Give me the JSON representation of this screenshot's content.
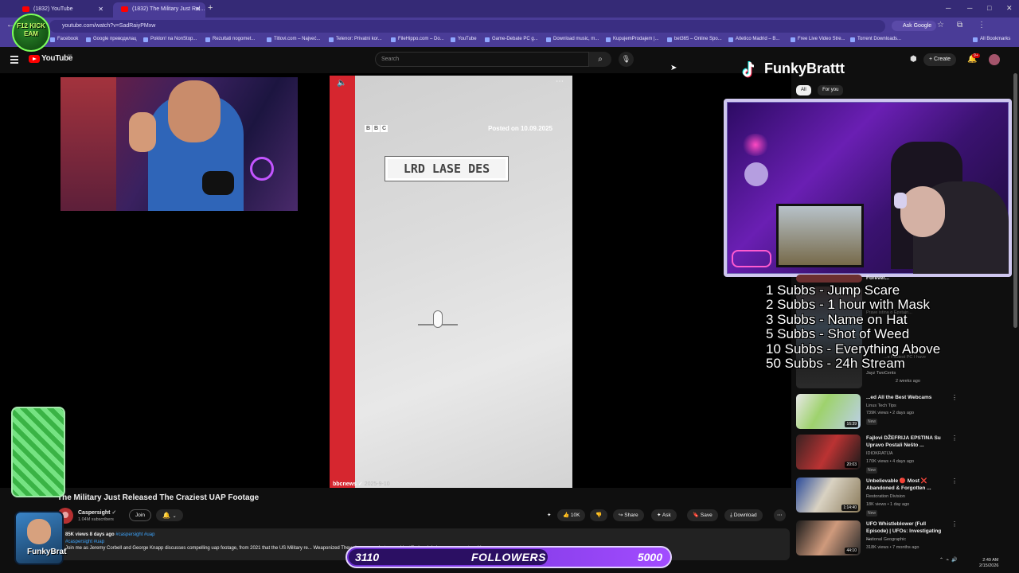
{
  "browser": {
    "tabs": [
      {
        "label": "(1832) YouTube",
        "active": false
      },
      {
        "label": "(1832) The Military Just Rel...",
        "active": true
      }
    ],
    "url": "youtube.com/watch?v=SadRaiyPMxw",
    "ask_google": "Ask Google",
    "bookmarks": [
      "Facebook",
      "Google преводилац",
      "Poklon! na NonStop...",
      "Rezultati nogomet...",
      "Titlovi.com – Najveć...",
      "Telenor: Privatni kor...",
      "FileHippo.com – Do...",
      "YouTube",
      "Game-Debate PC g...",
      "Download music, m...",
      "KupujemProdajem |...",
      "bet365 – Online Spo...",
      "Atletico Madrid – B...",
      "Free Live Video Stre...",
      "Torrent Downloads..."
    ],
    "all_bookmarks": "All Bookmarks"
  },
  "youtube": {
    "logo_text": "YouTube",
    "region": "RS",
    "search_placeholder": "Search",
    "create_label": "Create",
    "notifications_badge": "9+"
  },
  "overlay": {
    "kick_logo": "F12 KICK EAM",
    "tiktok_name": "FunkyBrattt",
    "filter_chips": [
      "All",
      "For you"
    ],
    "sub_goals": [
      "1 Subbs - Jump Scare",
      "2 Subbs - 1 hour with Mask",
      "3 Subbs - Name on Hat",
      "5 Subbs - Shot of Weed",
      "10 Subbs - Everything Above",
      "50 Subbs - 24h Stream"
    ],
    "followers_current": "3110",
    "followers_label": "FOLLOWERS",
    "followers_goal": "5000",
    "followers_progress": 0.622,
    "avatar_label": "FunkyBrat"
  },
  "video": {
    "bbc_logo": [
      "B",
      "B",
      "C"
    ],
    "posted_on": "Posted on 10.09.2025",
    "hud_text": "LRD LASE DES",
    "source": "bbcnews",
    "source_date": "2025-9-10",
    "title": "The Military Just Released The Craziest UAP Footage",
    "channel": "Caspersight",
    "subscribers": "1.04M subscribers",
    "join_label": "Join",
    "likes": "10K",
    "share_label": "Share",
    "ask_label": "Ask",
    "save_label": "Save",
    "download_label": "Download",
    "views_meta": "85K views  8 days ago",
    "hashtags": "#caspersight #uap",
    "hashtag2": "#caspersight #uap",
    "description": "Join me as Jeremy Corbell and George Knapp discusses compelling uap footage, from 2021 that the US Military re...  Weaponized They showcase what a... unidentified aerial phenomena captured by"
  },
  "sidebar": {
    "videos": [
      {
        "title": "Forever...",
        "channel": "",
        "views": "",
        "duration": ""
      },
      {
        "title": "...ed All the Best Webcams",
        "channel": "Linus Tech Tips",
        "views": "739K views • 2 days ago",
        "badge": "New",
        "duration": "16:39"
      },
      {
        "title": "Fajlovi DŽEFRIJA EPSTINA Su Upravo Postali Nešto ...",
        "channel": "IDIOKRATIJA",
        "views": "170K views • 4 days ago",
        "badge": "New",
        "duration": "20:03"
      },
      {
        "title": "Unbelievable 🔴 Most ❌ Abandoned & Forgotten ...",
        "channel": "Restoration Division",
        "views": "18K views • 1 day ago",
        "badge": "New",
        "duration": "1:14:40"
      },
      {
        "title": "UFO Whistleblower (Full Episode) | UFOs: Investigating ...",
        "channel": "National Geographic",
        "views": "318K views • 7 months ago",
        "badge": "",
        "duration": "44:10"
      }
    ],
    "hidden_titles": [
      "Prave istina o Epstajn...",
      "Jayz TwoCents",
      "2 weeks ago",
      "...e Fastest PC I have"
    ]
  },
  "tray": {
    "time": "2:49 AM",
    "date": "2/15/2026"
  },
  "colors": {
    "browser_chrome": "#4a3c97",
    "youtube_red": "#ff0000",
    "followers_bar": "#a24cff"
  }
}
